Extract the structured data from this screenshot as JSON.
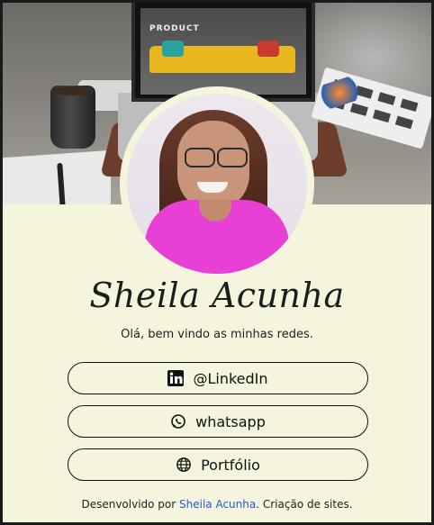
{
  "banner": {
    "screen_text": "PRODUCT"
  },
  "profile": {
    "name": "Sheila Acunha",
    "greeting": "Olá, bem vindo as minhas redes."
  },
  "links": [
    {
      "label": "@LinkedIn",
      "icon": "linkedin-icon"
    },
    {
      "label": "whatsapp",
      "icon": "whatsapp-icon"
    },
    {
      "label": "Portfólio",
      "icon": "globe-icon"
    }
  ],
  "footer": {
    "prefix": "Desenvolvido por ",
    "author_link": "Sheila Acunha",
    "suffix": ". Criação de sites."
  },
  "colors": {
    "background": "#f5f4dc",
    "link": "#1f5fd1",
    "shirt": "#e83fd6"
  }
}
